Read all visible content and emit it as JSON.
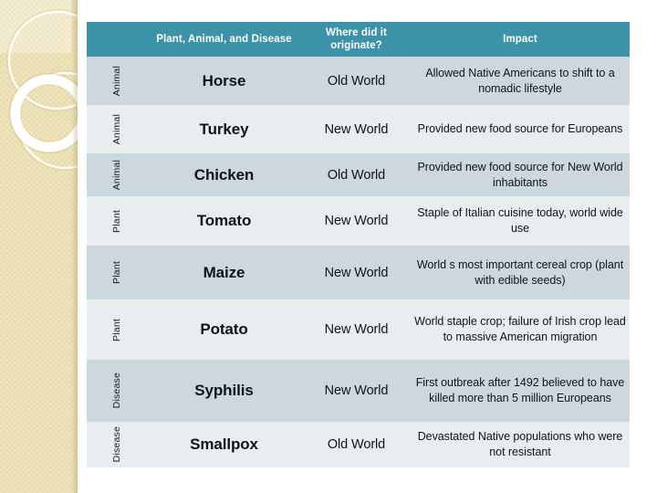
{
  "slide": {
    "background_color": "#ffffff",
    "sidebar": {
      "base_color": "#e9dcac",
      "ring_color": "#ffffff",
      "accent_outline_color": "#efe3bf"
    }
  },
  "table": {
    "header_color": "#3c92a8",
    "header_text_color": "#ffffff",
    "row_dark_color": "#ccd8dd",
    "row_light_color": "#e9edf0",
    "group_separator_color": "#c0634a",
    "columns": [
      {
        "key": "category",
        "label": ""
      },
      {
        "key": "name",
        "label": "Plant, Animal, and Disease"
      },
      {
        "key": "origin",
        "label": "Where did it originate?"
      },
      {
        "key": "impact",
        "label": "Impact"
      }
    ],
    "rows": [
      {
        "category": "Animal",
        "name": "Horse",
        "origin": "Old World",
        "impact": "Allowed Native Americans to shift to a nomadic lifestyle",
        "shade": "dark",
        "group_start": false
      },
      {
        "category": "Animal",
        "name": "Turkey",
        "origin": "New World",
        "impact": "Provided new food source for Europeans",
        "shade": "light",
        "group_start": false
      },
      {
        "category": "Animal",
        "name": "Chicken",
        "origin": "Old World",
        "impact": "Provided new food source for New World inhabitants",
        "shade": "dark",
        "group_start": false
      },
      {
        "category": "Plant",
        "name": "Tomato",
        "origin": "New World",
        "impact": "Staple of Italian cuisine today, world wide use",
        "shade": "light",
        "group_start": true
      },
      {
        "category": "Plant",
        "name": "Maize",
        "origin": "New World",
        "impact": "World s most important cereal crop (plant with edible seeds)",
        "shade": "dark",
        "group_start": false
      },
      {
        "category": "Plant",
        "name": "Potato",
        "origin": "New World",
        "impact": "World staple crop;  failure of Irish crop lead to massive American migration",
        "shade": "light",
        "group_start": false
      },
      {
        "category": "Disease",
        "name": "Syphilis",
        "origin": "New World",
        "impact": "First outbreak after 1492 believed to have killed more than 5 million Europeans",
        "shade": "dark",
        "group_start": true
      },
      {
        "category": "Disease",
        "name": "Smallpox",
        "origin": "Old World",
        "impact": "Devastated Native populations who were not resistant",
        "shade": "light",
        "group_start": false
      }
    ]
  }
}
